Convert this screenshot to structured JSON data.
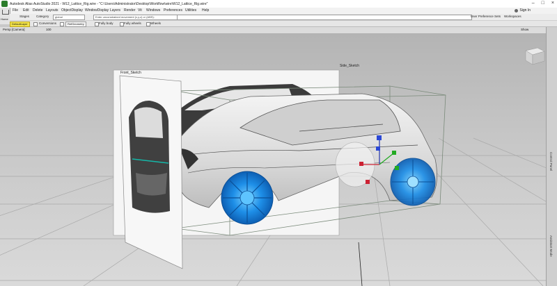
{
  "window": {
    "title": "Autodesk Alias AutoStudio 2021  -  W12_Lattice_Rig.wire - \"C:\\Users\\Administrator\\Desktop\\Workflow\\wire\\W12_Lattice_Rig.wire\"",
    "signin": "Sign In"
  },
  "menu": [
    "File",
    "Edit",
    "Delete",
    "Layouts",
    "ObjectDisplay",
    "WindowDisplay",
    "Layers",
    "Render",
    "Vit",
    "Windows",
    "Preferences",
    "Utilities",
    "Help"
  ],
  "home": {
    "label": "Home"
  },
  "toolbar": {
    "stages_label": "Stages",
    "category_label": "Category",
    "category_value": "global",
    "prompt_value": "Enter unconstrained movement (x,y,z) or (ABS):",
    "user_prefs": "User Preference Sets",
    "workspaces": "Workspaces"
  },
  "toolbar2": {
    "default_label": "DefaultLayer",
    "conversions": "Conversions",
    "rfx_geometry": "RefGeometry",
    "fully_body": "Fully body",
    "fully_wheels": "Fully wheels",
    "wheels": "Wheels"
  },
  "viewport": {
    "name": "Persp [Camera]",
    "zoom": "100",
    "show_label": "Show"
  },
  "scene": {
    "front_sketch": "Front_Sketch",
    "side_sketch": "Side_Sketch"
  },
  "panel": {
    "label": "Control Panel",
    "label2": "Assistant Mode"
  },
  "colors": {
    "wheel": "#1e8fe8",
    "wheel_highlight": "#5ec4ff",
    "active_layer": "#f3e34a",
    "grid": "#a9a9a9"
  }
}
